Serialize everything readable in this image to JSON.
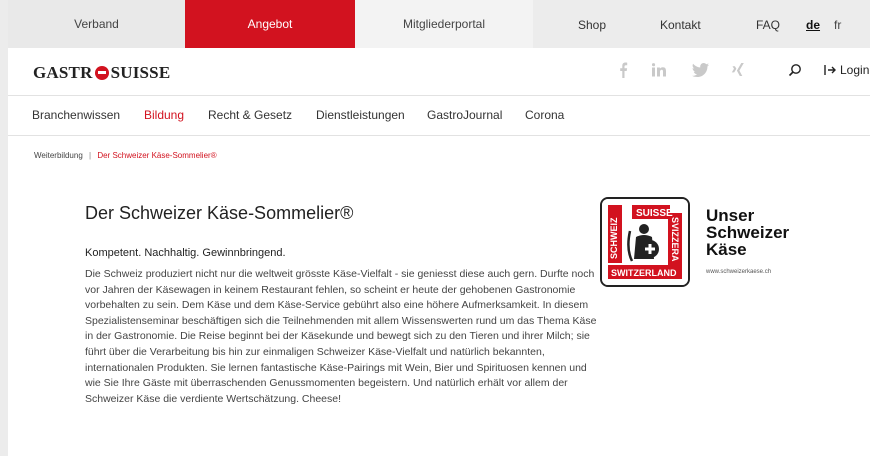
{
  "topbar": {
    "items": [
      {
        "label": "Verband"
      },
      {
        "label": "Angebot"
      },
      {
        "label": "Mitgliederportal"
      },
      {
        "label": "Shop"
      },
      {
        "label": "Kontakt"
      },
      {
        "label": "FAQ"
      }
    ],
    "languages": [
      {
        "label": "de",
        "active": true
      },
      {
        "label": "fr",
        "active": false
      }
    ],
    "colors": {
      "accent": "#d2121f"
    }
  },
  "header": {
    "logo": {
      "part1": "GASTR",
      "part2": "SUISSE"
    },
    "social_icons": [
      "facebook-icon",
      "linkedin-icon",
      "twitter-icon",
      "xing-icon"
    ],
    "search_icon": "search-icon",
    "login_label": "Login"
  },
  "nav": {
    "items": [
      {
        "label": "Branchenwissen"
      },
      {
        "label": "Bildung"
      },
      {
        "label": "Recht & Gesetz"
      },
      {
        "label": "Dienstleistungen"
      },
      {
        "label": "GastroJournal"
      },
      {
        "label": "Corona"
      }
    ]
  },
  "breadcrumb": {
    "items": [
      {
        "label": "Weiterbildung"
      },
      {
        "label": "Der Schweizer Käse-Sommelier®"
      }
    ],
    "separator": "|"
  },
  "content": {
    "title": "Der Schweizer Käse-Sommelier®",
    "subtitle": "Kompetent. Nachhaltig. Gewinnbringend.",
    "body": "Die Schweiz produziert nicht nur die weltweit grösste Käse-Vielfalt - sie geniesst diese auch gern. Durfte noch vor Jahren der Käsewagen in keinem Restaurant fehlen, so scheint er heute der gehobenen Gastronomie vorbehalten zu sein. Dem Käse und dem Käse-Service gebührt also eine höhere Aufmerksamkeit. In diesem Spezialistenseminar beschäftigen sich die Teilnehmenden mit allem Wissenswerten rund um das Thema Käse in der Gastronomie. Die Reise beginnt bei der Käsekunde und bewegt sich zu den Tieren und ihrer Milch; sie führt über die Verarbeitung bis hin zur einmaligen Schweizer Käse-Vielfalt und natürlich bekannten, internationalen Produkten. Sie lernen fantastische Käse-Pairings mit Wein, Bier und Spirituosen kennen und wie Sie Ihre Gäste mit überraschenden Genussmomenten begeistern. Und natürlich erhält vor allem der Schweizer Käse die verdiente Wertschätzung. Cheese!"
  },
  "cheese_logo": {
    "badge_words": [
      "SCHWEIZ",
      "SUISSE",
      "SVIZZERA",
      "SWITZERLAND"
    ],
    "line1": "Unser",
    "line2": "Schweizer",
    "line3": "Käse",
    "url": "www.schweizerkaese.ch"
  }
}
